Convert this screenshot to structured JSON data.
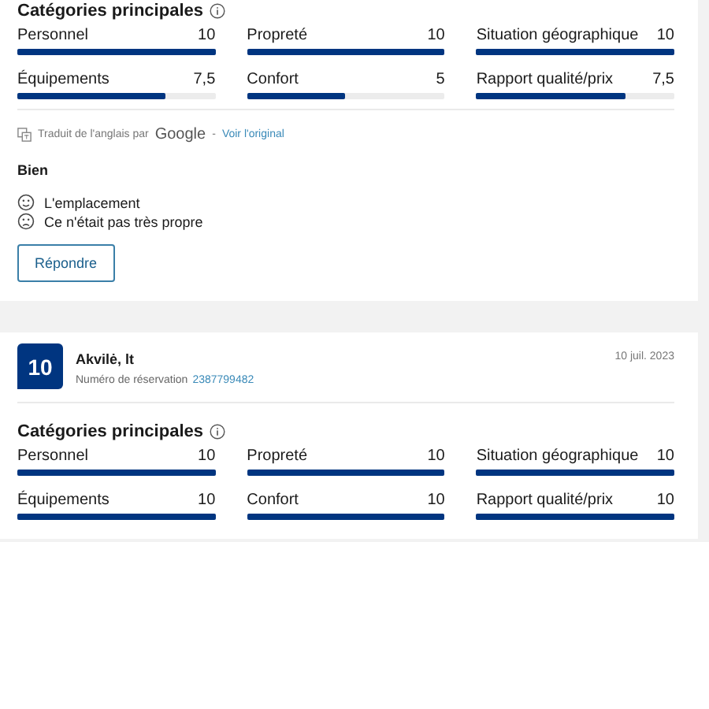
{
  "reviews": [
    {
      "categories_title": "Catégories principales",
      "categories": [
        {
          "label": "Personnel",
          "score": "10",
          "level": 1
        },
        {
          "label": "Propreté",
          "score": "10",
          "level": 1
        },
        {
          "label": "Situation géographique",
          "score": "10",
          "level": 1
        },
        {
          "label": "Équipements",
          "score": "7,5",
          "level": 0.75
        },
        {
          "label": "Confort",
          "score": "5",
          "level": 0.5
        },
        {
          "label": "Rapport qualité/prix",
          "score": "7,5",
          "level": 0.75
        }
      ],
      "translation": {
        "text": "Traduit de l'anglais par",
        "brand": "Google",
        "separator": "-",
        "link": "Voir l'original"
      },
      "title": "Bien",
      "points": [
        {
          "kind": "positive",
          "text": "L'emplacement"
        },
        {
          "kind": "negative",
          "text": "Ce n'était pas très propre"
        }
      ],
      "reply_button": "Répondre"
    },
    {
      "score": "10",
      "author": "Akvilė, lt",
      "booking_label": "Numéro de réservation",
      "booking_number": "2387799482",
      "date": "10 juil. 2023",
      "categories_title": "Catégories principales",
      "categories": [
        {
          "label": "Personnel",
          "score": "10",
          "level": 1
        },
        {
          "label": "Propreté",
          "score": "10",
          "level": 1
        },
        {
          "label": "Situation géographique",
          "score": "10",
          "level": 1
        },
        {
          "label": "Équipements",
          "score": "10",
          "level": 1
        },
        {
          "label": "Confort",
          "score": "10",
          "level": 1
        },
        {
          "label": "Rapport qualité/prix",
          "score": "10",
          "level": 1
        }
      ]
    }
  ]
}
